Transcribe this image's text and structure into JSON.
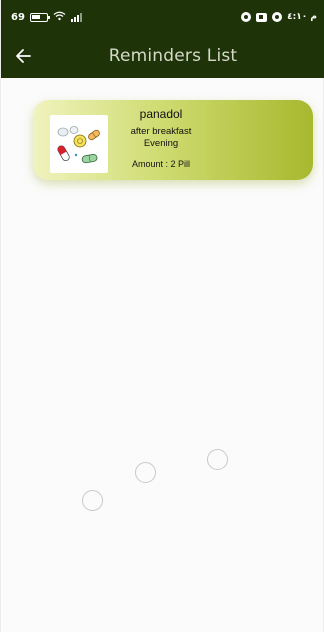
{
  "status_bar": {
    "battery_level": "69",
    "clock": "م ٤:١٠",
    "icons": [
      "battery-icon",
      "wifi-icon",
      "signal-icon",
      "notification-icon",
      "video-icon",
      "notification-icon"
    ]
  },
  "app_bar": {
    "title": "Reminders List",
    "back_icon": "arrow-left-icon"
  },
  "reminders": [
    {
      "name": "panadol",
      "timing": "after breakfast",
      "period": "Evening",
      "amount": "Amount : 2 Pill",
      "image_icon": "pills-illustration"
    }
  ],
  "colors": {
    "app_bar_bg": "#1e3408",
    "card_gradient_start": "#f0f3bd",
    "card_gradient_end": "#a8b82e"
  }
}
